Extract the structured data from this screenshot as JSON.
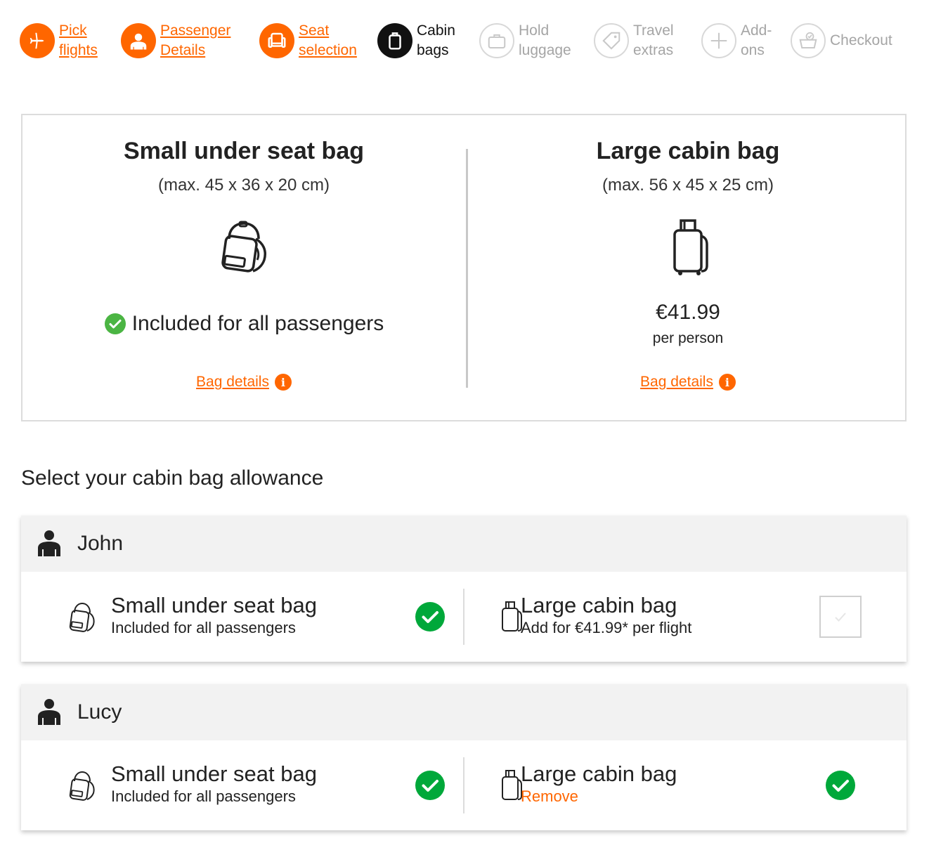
{
  "stepper": {
    "steps": [
      {
        "line1": "Pick",
        "line2": "flights",
        "state": "done",
        "icon": "plane-icon"
      },
      {
        "line1": "Passenger",
        "line2": "Details",
        "state": "done",
        "icon": "person-icon"
      },
      {
        "line1": "Seat",
        "line2": "selection",
        "state": "done",
        "icon": "seat-icon"
      },
      {
        "line1": "Cabin",
        "line2": "bags",
        "state": "current",
        "icon": "suitcase-icon"
      },
      {
        "line1": "Hold",
        "line2": "luggage",
        "state": "future",
        "icon": "hold-luggage-icon"
      },
      {
        "line1": "Travel",
        "line2": "extras",
        "state": "future",
        "icon": "tag-icon"
      },
      {
        "line1": "Add-",
        "line2": "ons",
        "state": "future",
        "icon": "plus-icon"
      },
      {
        "line1": "Checkout",
        "line2": "",
        "state": "future",
        "icon": "basket-icon"
      }
    ]
  },
  "bags": {
    "small": {
      "title": "Small under seat bag",
      "dimensions": "(max. 45 x 36 x 20 cm)",
      "included": "Included for all passengers",
      "details_link": "Bag details "
    },
    "large": {
      "title": "Large cabin bag",
      "dimensions": "(max. 56 x 45 x 25 cm)",
      "price": "€41.99",
      "price_unit": "per person",
      "details_link": "Bag details "
    }
  },
  "allowance": {
    "title": "Select your cabin bag allowance",
    "passengers": [
      {
        "name": "John",
        "small": {
          "title": "Small under seat bag",
          "sub": "Included for all passengers",
          "selected": true
        },
        "large": {
          "title": "Large cabin bag",
          "sub": "Add for €41.99* per flight",
          "selected": false
        }
      },
      {
        "name": "Lucy",
        "small": {
          "title": "Small under seat bag",
          "sub": "Included for all passengers",
          "selected": true
        },
        "large": {
          "title": "Large cabin bag",
          "sub": "Remove",
          "selected": true
        }
      }
    ]
  },
  "colors": {
    "accent": "#ff6600",
    "success": "#00a83a",
    "current_step": "#111111",
    "muted": "#a5a5a5"
  }
}
